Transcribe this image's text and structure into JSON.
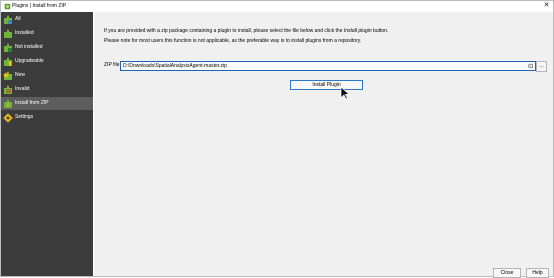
{
  "window": {
    "title": "Plugins | Install from ZIP"
  },
  "sidebar": {
    "items": [
      {
        "label": "All",
        "icon": "puzzle-all-icon"
      },
      {
        "label": "Installed",
        "icon": "puzzle-installed-icon"
      },
      {
        "label": "Not installed",
        "icon": "puzzle-not-installed-icon"
      },
      {
        "label": "Upgradeable",
        "icon": "puzzle-upgrade-icon"
      },
      {
        "label": "New",
        "icon": "puzzle-new-icon"
      },
      {
        "label": "Invalid",
        "icon": "puzzle-invalid-icon"
      },
      {
        "label": "Install from ZIP",
        "icon": "puzzle-zip-icon",
        "active": true
      },
      {
        "label": "Settings",
        "icon": "gear-icon"
      }
    ]
  },
  "main": {
    "description_pre": "If you are provided with a zip package containing a plugin to install, please select the file below and click the ",
    "description_em": "Install plugin",
    "description_post": " button.",
    "note": "Please note for most users this function is not applicable, as the preferable way is to install plugins from a repository.",
    "zip_label": "ZIP file",
    "zip_value": "D:\\Downloads\\SpatialAnalysisAgent-master.zip",
    "browse_label": "…",
    "install_button": "Install Plugin"
  },
  "footer": {
    "close_label": "Close",
    "help_label": "Help"
  },
  "colors": {
    "sidebar_bg": "#3c3c3c",
    "active_bg": "#5d5d5d",
    "accent": "#1f64b4"
  }
}
